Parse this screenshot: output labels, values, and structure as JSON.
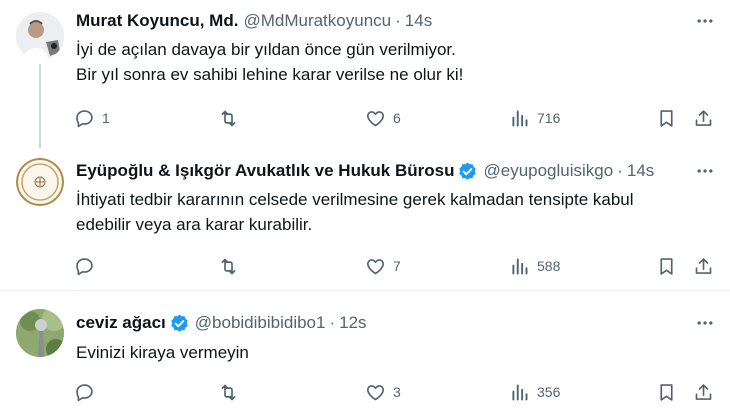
{
  "tweets": [
    {
      "name": "Murat Koyuncu, Md.",
      "handle": "@MdMuratkoyuncu",
      "time": "14s",
      "text_lines": [
        "İyi de açılan davaya bir yıldan önce gün verilmiyor.",
        "Bir yıl sonra ev sahibi lehine karar verilse ne olur ki!"
      ],
      "replies": "1",
      "retweets": "",
      "likes": "6",
      "views": "716",
      "verified": false
    },
    {
      "name": "Eyüpoğlu & Işıkgör Avukatlık ve Hukuk Bürosu",
      "handle": "@eyupogluisikgo",
      "time": "14s",
      "text_lines": [
        "İhtiyati tedbir kararının celsede verilmesine gerek kalmadan tensipte kabul",
        "edebilir veya ara karar kurabilir."
      ],
      "replies": "",
      "retweets": "",
      "likes": "7",
      "views": "588",
      "verified": true
    },
    {
      "name": "ceviz ağacı",
      "handle": "@bobidibibidibo1",
      "time": "12s",
      "text_lines": [
        "Evinizi kiraya vermeyin"
      ],
      "replies": "",
      "retweets": "",
      "likes": "3",
      "views": "356",
      "verified": true
    }
  ],
  "colors": {
    "text": "#0f1419",
    "secondary": "#536471",
    "verified": "#1d9bf0",
    "divider": "#eff3f4",
    "thread_line": "#cfd9de"
  },
  "icons": [
    "reply-icon",
    "retweet-icon",
    "like-icon",
    "views-icon",
    "bookmark-icon",
    "share-icon",
    "more-icon",
    "verified-badge-icon"
  ]
}
